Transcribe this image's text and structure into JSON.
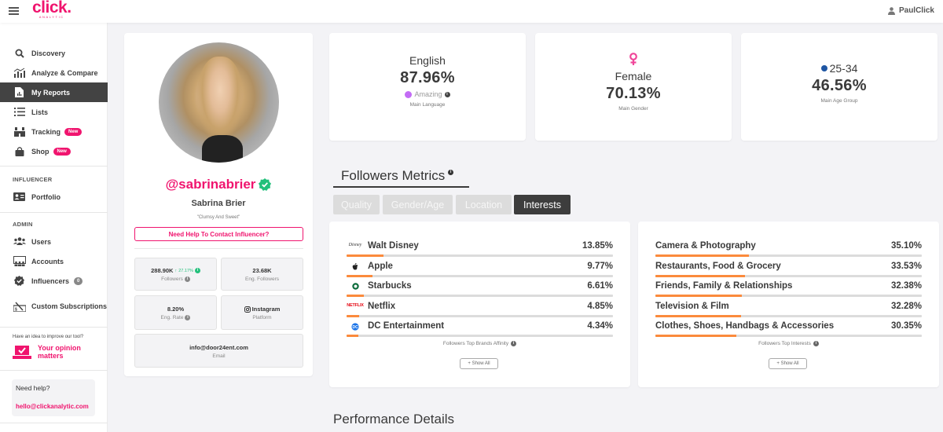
{
  "topbar": {
    "logo_main": "click.",
    "logo_sub": "ANALYTIC",
    "user_name": "PaulClick"
  },
  "sidebar": {
    "items": [
      {
        "label": "Discovery",
        "icon": "search-icon"
      },
      {
        "label": "Analyze & Compare",
        "icon": "chart-icon"
      },
      {
        "label": "My Reports",
        "icon": "report-icon",
        "active": true
      },
      {
        "label": "Lists",
        "icon": "list-icon"
      },
      {
        "label": "Tracking",
        "icon": "binoculars-icon",
        "badge": "New"
      },
      {
        "label": "Shop",
        "icon": "shopping-bag-icon",
        "badge": "New"
      }
    ],
    "influencer_section": "INFLUENCER",
    "influencer_items": [
      {
        "label": "Portfolio",
        "icon": "id-card-icon"
      }
    ],
    "admin_section": "ADMIN",
    "admin_items": [
      {
        "label": "Users",
        "icon": "users-icon"
      },
      {
        "label": "Accounts",
        "icon": "accounts-icon"
      },
      {
        "label": "Influencers",
        "icon": "verified-badge-icon",
        "count": "0"
      },
      {
        "label": "Custom Subscriptions",
        "icon": "subscription-icon"
      }
    ],
    "idea_text": "Have an idea to improve our tool?",
    "opinion_label": "Your opinion matters",
    "help_title": "Need help?",
    "help_email": "hello@clickanalytic.com"
  },
  "profile": {
    "handle": "@sabrinabrier",
    "verified": true,
    "full_name": "Sabrina Brier",
    "bio": "\"Clumsy And Sweet\"",
    "contact_button": "Need Help To Contact Influencer?",
    "stats": {
      "followers_value": "288.90K",
      "followers_growth": "27.17%",
      "followers_label": "Followers",
      "eng_followers_value": "23.68K",
      "eng_followers_label": "Eng. Followers",
      "eng_rate_value": "8.20%",
      "eng_rate_label": "Eng. Rate",
      "platform_value": "Instagram",
      "platform_label": "Platform",
      "email_value": "info@door24ent.com",
      "email_label": "Email"
    }
  },
  "metrics": {
    "language": {
      "title": "English",
      "value": "87.96%",
      "quality": "Amazing",
      "quality_color": "#c36cf5",
      "caption": "Main Language"
    },
    "gender": {
      "title": "Female",
      "value": "70.13%",
      "caption": "Main Gender",
      "icon_color": "#f0479a"
    },
    "age": {
      "title": "25-34",
      "value": "46.56%",
      "caption": "Main Age Group",
      "dot_color": "#1f56a3"
    }
  },
  "followers_metrics": {
    "title": "Followers Metrics",
    "tabs": [
      {
        "label": "Quality",
        "active": false
      },
      {
        "label": "Gender/Age",
        "active": false
      },
      {
        "label": "Location",
        "active": false
      },
      {
        "label": "Interests",
        "active": true
      }
    ],
    "brands": {
      "items": [
        {
          "name": "Walt Disney",
          "pct": "13.85%",
          "value": 13.85,
          "icon": "disney-logo-icon"
        },
        {
          "name": "Apple",
          "pct": "9.77%",
          "value": 9.77,
          "icon": "apple-logo-icon"
        },
        {
          "name": "Starbucks",
          "pct": "6.61%",
          "value": 6.61,
          "icon": "starbucks-logo-icon"
        },
        {
          "name": "Netflix",
          "pct": "4.85%",
          "value": 4.85,
          "icon": "netflix-logo-icon"
        },
        {
          "name": "DC Entertainment",
          "pct": "4.34%",
          "value": 4.34,
          "icon": "dc-logo-icon"
        }
      ],
      "caption": "Followers Top Brands Affinity",
      "show_all": "+ Show All"
    },
    "interests": {
      "items": [
        {
          "name": "Camera & Photography",
          "pct": "35.10%",
          "value": 35.1
        },
        {
          "name": "Restaurants, Food & Grocery",
          "pct": "33.53%",
          "value": 33.53
        },
        {
          "name": "Friends, Family & Relationships",
          "pct": "32.38%",
          "value": 32.38
        },
        {
          "name": "Television & Film",
          "pct": "32.28%",
          "value": 32.28
        },
        {
          "name": "Clothes, Shoes, Handbags & Accessories",
          "pct": "30.35%",
          "value": 30.35
        }
      ],
      "caption": "Followers Top Interests",
      "show_all": "+ Show All"
    }
  },
  "performance_title": "Performance Details",
  "colors": {
    "brand": "#f0146e",
    "bar_fill": "#fb8a3c",
    "bar_track": "#dcdcdc",
    "growth": "#22c07b"
  }
}
